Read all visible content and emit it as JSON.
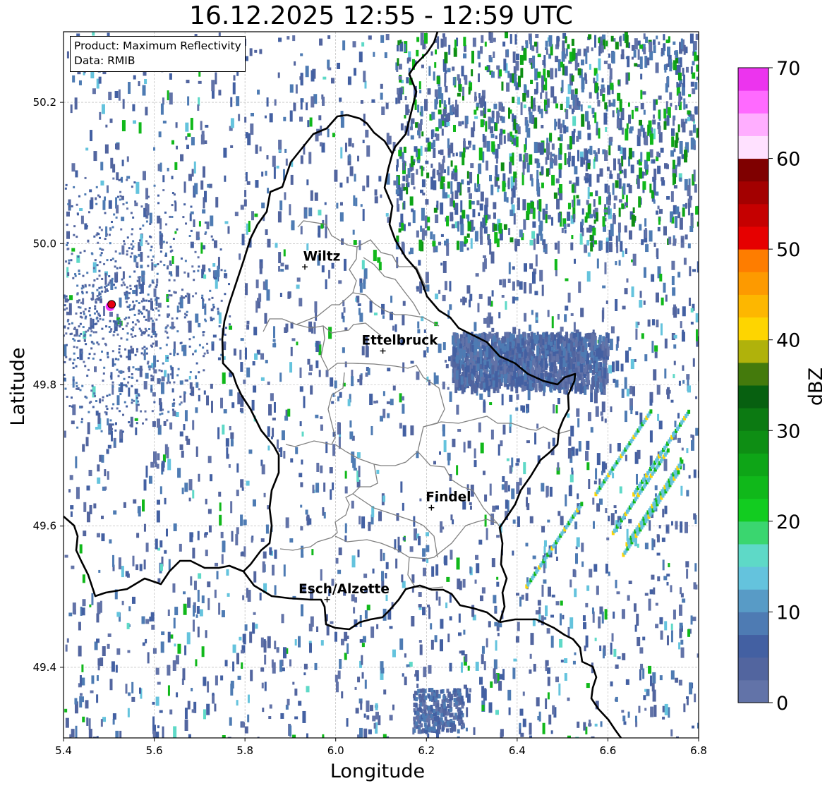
{
  "title": "16.12.2025 12:55 - 12:59 UTC",
  "info_box": {
    "product_line": "Product: Maximum Reflectivity",
    "data_line": "Data: RMIB"
  },
  "axes": {
    "xlabel": "Longitude",
    "ylabel": "Latitude",
    "xlim": [
      5.4,
      6.8
    ],
    "ylim": [
      49.3,
      50.3
    ],
    "xticks": [
      5.4,
      5.6,
      5.8,
      6.0,
      6.2,
      6.4,
      6.6,
      6.8
    ],
    "xtick_labels": [
      "5.4",
      "5.6",
      "5.8",
      "6.0",
      "6.2",
      "6.4",
      "6.6",
      "6.8"
    ],
    "yticks": [
      49.4,
      49.6,
      49.8,
      50.0,
      50.2
    ],
    "ytick_labels": [
      "49.4",
      "49.6",
      "49.8",
      "50.0",
      "50.2"
    ],
    "grid": true
  },
  "cities": [
    {
      "name": "Wiltz",
      "lon": 5.932,
      "lat": 49.967
    },
    {
      "name": "Ettelbruck",
      "lon": 6.104,
      "lat": 49.848
    },
    {
      "name": "Findel",
      "lon": 6.211,
      "lat": 49.626
    },
    {
      "name": "Esch/Alzette",
      "lon": 5.981,
      "lat": 49.496
    }
  ],
  "radar_site": {
    "lon": 5.506,
    "lat": 49.914
  },
  "colorbar": {
    "label": "dBZ",
    "min": 0,
    "max": 70,
    "ticks": [
      0,
      10,
      20,
      30,
      40,
      50,
      60,
      70
    ],
    "tick_labels": [
      "0",
      "10",
      "20",
      "30",
      "40",
      "50",
      "60",
      "70"
    ],
    "colors": [
      "#6273a8",
      "#52659f",
      "#4360a2",
      "#4e7bb3",
      "#589bc6",
      "#64c3dd",
      "#5ed9c7",
      "#3ad66f",
      "#12cc20",
      "#10b81a",
      "#0ea517",
      "#0e8e14",
      "#0c7a12",
      "#076010",
      "#447a0c",
      "#b0b20b",
      "#fed500",
      "#fdb700",
      "#fd9a00",
      "#fe7d00",
      "#e60000",
      "#c50000",
      "#a30000",
      "#7f0000",
      "#ffe1ff",
      "#ffaeff",
      "#ff6aff",
      "#ec34ee"
    ]
  }
}
